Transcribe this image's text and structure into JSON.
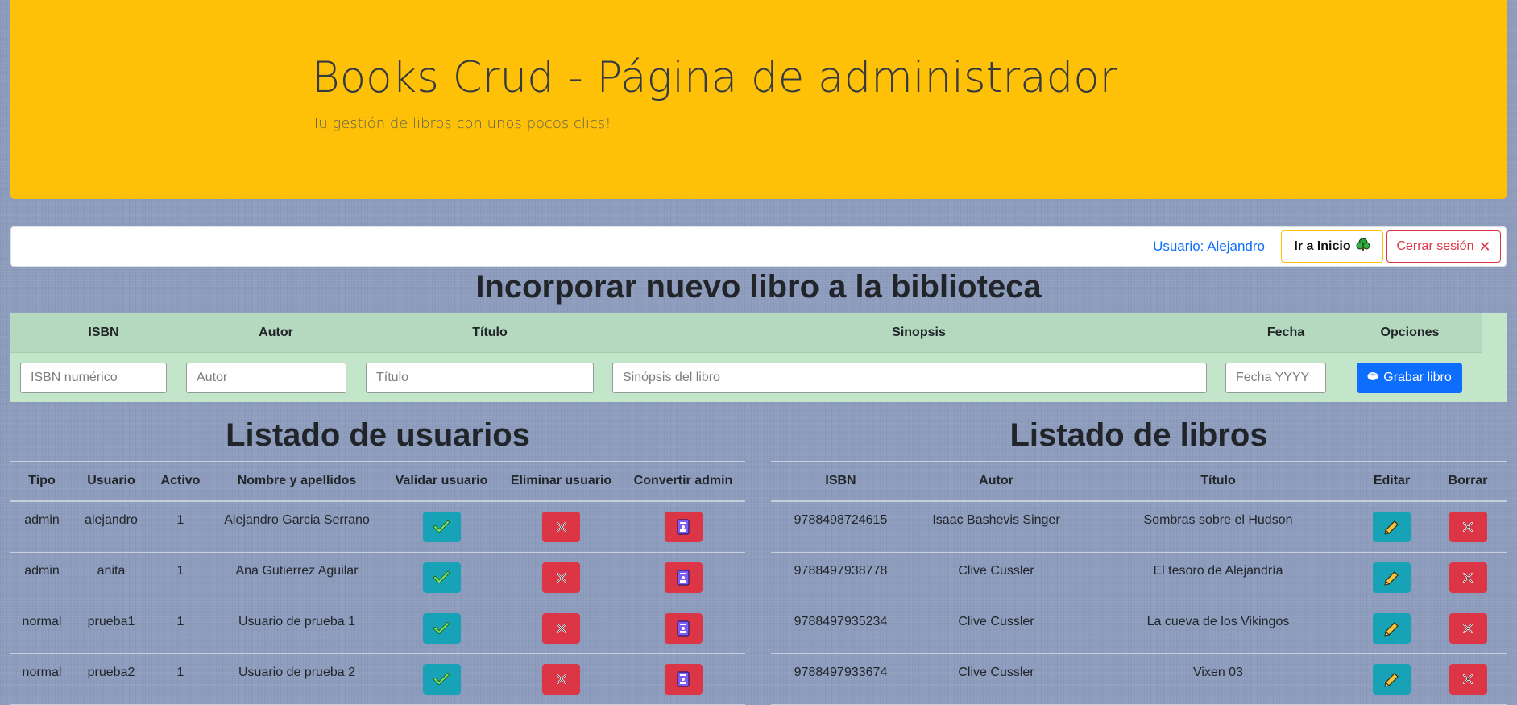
{
  "header": {
    "title": "Books Crud - Página de administrador",
    "subtitle": "Tu gestión de libros con unos pocos clics!"
  },
  "nav": {
    "user_label": "Usuario: Alejandro",
    "home_label": "Ir a Inicio",
    "logout_label": "Cerrar sesión"
  },
  "new_book": {
    "title": "Incorporar nuevo libro a la biblioteca",
    "columns": [
      "ISBN",
      "Autor",
      "Título",
      "Sinopsis",
      "Fecha",
      "Opciones"
    ],
    "placeholders": {
      "isbn": "ISBN numérico",
      "autor": "Autor",
      "titulo": "Título",
      "sinopsis": "Sinópsis del libro",
      "fecha": "Fecha YYYY"
    },
    "save_label": "Grabar libro"
  },
  "users": {
    "title": "Listado de usuarios",
    "columns": [
      "Tipo",
      "Usuario",
      "Activo",
      "Nombre y apellidos",
      "Validar usuario",
      "Eliminar usuario",
      "Convertir admin"
    ],
    "rows": [
      {
        "tipo": "admin",
        "usuario": "alejandro",
        "activo": "1",
        "nombre": "Alejandro Garcia Serrano"
      },
      {
        "tipo": "admin",
        "usuario": "anita",
        "activo": "1",
        "nombre": "Ana Gutierrez Aguilar"
      },
      {
        "tipo": "normal",
        "usuario": "prueba1",
        "activo": "1",
        "nombre": "Usuario de prueba 1"
      },
      {
        "tipo": "normal",
        "usuario": "prueba2",
        "activo": "1",
        "nombre": "Usuario de prueba 2"
      }
    ]
  },
  "books": {
    "title": "Listado de libros",
    "columns": [
      "ISBN",
      "Autor",
      "Título",
      "Editar",
      "Borrar"
    ],
    "rows": [
      {
        "isbn": "9788498724615",
        "autor": "Isaac Bashevis Singer",
        "titulo": "Sombras sobre el Hudson"
      },
      {
        "isbn": "9788497938778",
        "autor": "Clive Cussler",
        "titulo": "El tesoro de Alejandría"
      },
      {
        "isbn": "9788497935234",
        "autor": "Clive Cussler",
        "titulo": "La cueva de los Vikingos"
      },
      {
        "isbn": "9788497933674",
        "autor": "Clive Cussler",
        "titulo": "Vixen 03"
      }
    ]
  },
  "colors": {
    "header_bg": "#ffc107",
    "form_bg": "#c3e6cb",
    "primary": "#0d6efd",
    "danger": "#dc3545",
    "info": "#17a2b8"
  },
  "icons": {
    "home": "tree-icon",
    "logout": "close-icon",
    "save": "disk-icon",
    "validate": "check-icon",
    "delete": "x-icon",
    "admin": "id-badge-icon",
    "edit": "pencil-icon"
  }
}
